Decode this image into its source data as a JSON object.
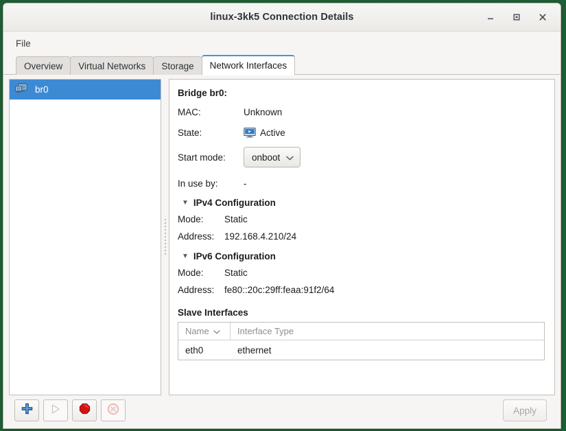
{
  "window": {
    "title": "linux-3kk5 Connection Details",
    "controls": {
      "minimize": "minimize-icon",
      "maximize": "maximize-icon",
      "close": "close-icon"
    }
  },
  "menubar": {
    "items": [
      {
        "label": "File"
      }
    ]
  },
  "tabs": [
    {
      "label": "Overview",
      "active": false
    },
    {
      "label": "Virtual Networks",
      "active": false
    },
    {
      "label": "Storage",
      "active": false
    },
    {
      "label": "Network Interfaces",
      "active": true
    }
  ],
  "interface_list": [
    {
      "name": "br0",
      "icon": "network-interface-icon",
      "selected": true
    }
  ],
  "details": {
    "heading": "Bridge br0:",
    "mac_label": "MAC:",
    "mac_value": "Unknown",
    "state_label": "State:",
    "state_value": "Active",
    "state_icon": "active-monitor-icon",
    "start_mode_label": "Start mode:",
    "start_mode_value": "onboot",
    "start_mode_options": [
      "onboot"
    ],
    "in_use_by_label": "In use by:",
    "in_use_by_value": "-",
    "ipv4": {
      "title": "IPv4 Configuration",
      "expanded": true,
      "mode_label": "Mode:",
      "mode_value": "Static",
      "address_label": "Address:",
      "address_value": "192.168.4.210/24"
    },
    "ipv6": {
      "title": "IPv6 Configuration",
      "expanded": true,
      "mode_label": "Mode:",
      "mode_value": "Static",
      "address_label": "Address:",
      "address_value": "fe80::20c:29ff:feaa:91f2/64"
    },
    "slaves": {
      "title": "Slave Interfaces",
      "columns": [
        "Name",
        "Interface Type"
      ],
      "sort_column": "Name",
      "rows": [
        {
          "name": "eth0",
          "type": "ethernet"
        }
      ]
    }
  },
  "toolbar": {
    "add": {
      "name": "add-interface-button",
      "icon": "plus-icon",
      "enabled": true
    },
    "start": {
      "name": "start-interface-button",
      "icon": "play-icon",
      "enabled": false
    },
    "stop": {
      "name": "stop-interface-button",
      "icon": "stop-octagon-icon",
      "enabled": true
    },
    "delete": {
      "name": "delete-interface-button",
      "icon": "circle-x-icon",
      "enabled": false
    },
    "apply_label": "Apply",
    "apply_enabled": false
  },
  "colors": {
    "desktop": "#1e5e33",
    "selection": "#3d8ad4",
    "active_tab_accent": "#4a90d9",
    "add_icon": "#3465a4",
    "stop_icon": "#cc0000",
    "delete_icon": "#e89a9a"
  }
}
